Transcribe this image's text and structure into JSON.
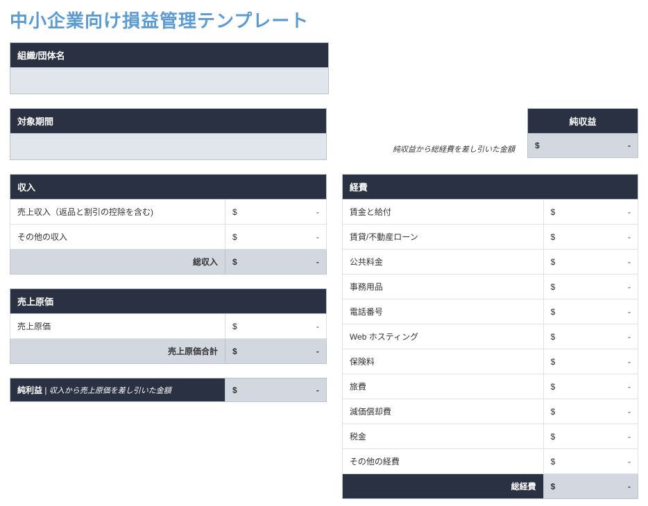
{
  "title": "中小企業向け損益管理テンプレート",
  "org_label": "組織/団体名",
  "period_label": "対象期間",
  "netincome": {
    "label": "純収益",
    "currency": "$",
    "value": "-",
    "note": "純収益から総経費を差し引いた金額"
  },
  "income": {
    "header": "収入",
    "rows": [
      {
        "label": "売上収入（返品と割引の控除を含む)",
        "currency": "$",
        "value": "-"
      },
      {
        "label": "その他の収入",
        "currency": "$",
        "value": "-"
      }
    ],
    "total_label": "総収入",
    "total_currency": "$",
    "total_value": "-"
  },
  "cogs": {
    "header": "売上原価",
    "rows": [
      {
        "label": "売上原価",
        "currency": "$",
        "value": "-"
      }
    ],
    "total_label": "売上原価合計",
    "total_currency": "$",
    "total_value": "-"
  },
  "netprofit": {
    "label": "純利益",
    "sep": " | ",
    "note": "収入から売上原価を差し引いた金額",
    "currency": "$",
    "value": "-"
  },
  "expenses": {
    "header": "経費",
    "rows": [
      {
        "label": "賃金と給付",
        "currency": "$",
        "value": "-"
      },
      {
        "label": "賃貸/不動産ローン",
        "currency": "$",
        "value": "-"
      },
      {
        "label": "公共料金",
        "currency": "$",
        "value": "-"
      },
      {
        "label": "事務用品",
        "currency": "$",
        "value": "-"
      },
      {
        "label": "電話番号",
        "currency": "$",
        "value": "-"
      },
      {
        "label": "Web ホスティング",
        "currency": "$",
        "value": "-"
      },
      {
        "label": "保険料",
        "currency": "$",
        "value": "-"
      },
      {
        "label": "旅費",
        "currency": "$",
        "value": "-"
      },
      {
        "label": "減価償却費",
        "currency": "$",
        "value": "-"
      },
      {
        "label": "税金",
        "currency": "$",
        "value": "-"
      },
      {
        "label": "その他の経費",
        "currency": "$",
        "value": "-"
      }
    ],
    "total_label": "総経費",
    "total_currency": "$",
    "total_value": "-"
  }
}
